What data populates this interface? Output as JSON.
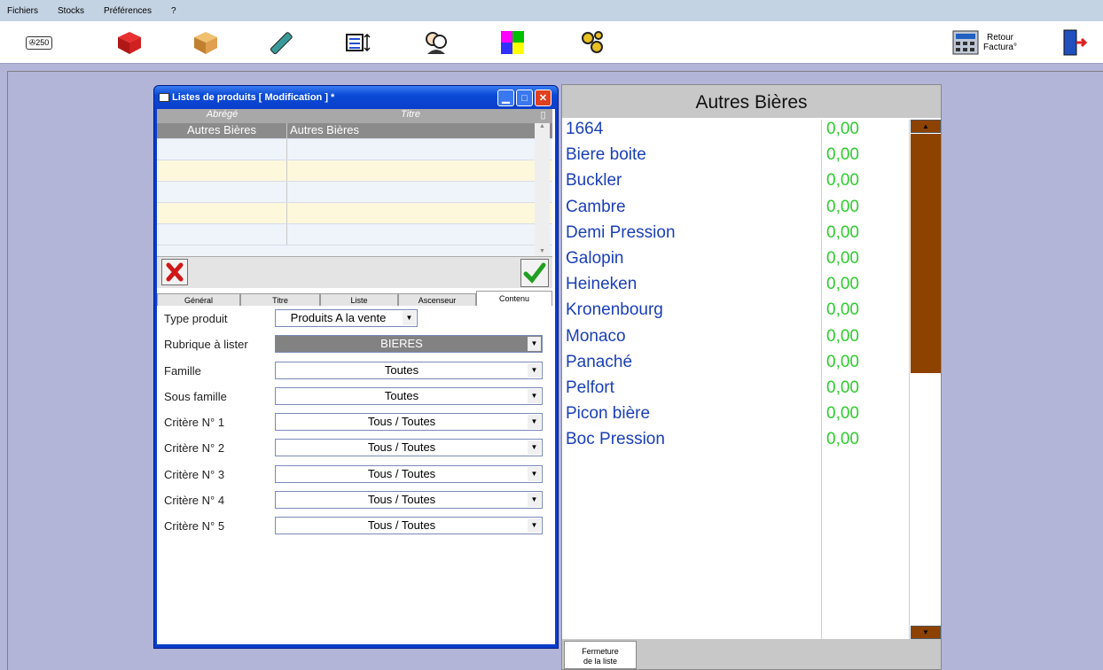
{
  "menu": [
    "Fichiers",
    "Stocks",
    "Préférences",
    "?"
  ],
  "toolbar": {
    "retour_label": "Retour\nFactura°",
    "price_icon_text": "250"
  },
  "dialog": {
    "title": "Listes de produits  [ Modification ] *",
    "grid": {
      "headers": [
        "Abrégé",
        "Titre"
      ],
      "rows": [
        [
          "Autres Bières",
          "Autres Bières"
        ],
        [
          "",
          ""
        ],
        [
          "",
          ""
        ],
        [
          "",
          ""
        ],
        [
          "",
          ""
        ],
        [
          "",
          ""
        ]
      ]
    },
    "tabs": [
      "Général",
      "Titre",
      "Liste",
      "Ascenseur",
      "Contenu"
    ],
    "active_tab": "Contenu",
    "fields": [
      {
        "label": "Type produit",
        "value": "Produits A la vente"
      },
      {
        "label": "Rubrique à lister",
        "value": "BIERES"
      },
      {
        "label": "Famille",
        "value": "Toutes"
      },
      {
        "label": "Sous famille",
        "value": "Toutes"
      },
      {
        "label": "Critère N° 1",
        "value": "Tous / Toutes"
      },
      {
        "label": "Critère N° 2",
        "value": "Tous / Toutes"
      },
      {
        "label": "Critère N° 3",
        "value": "Tous / Toutes"
      },
      {
        "label": "Critère N° 4",
        "value": "Tous / Toutes"
      },
      {
        "label": "Critère N° 5",
        "value": "Tous / Toutes"
      }
    ]
  },
  "panel": {
    "title": "Autres Bières",
    "items": [
      {
        "name": "1664",
        "price": "0,00"
      },
      {
        "name": "Biere boite",
        "price": "0,00"
      },
      {
        "name": "Buckler",
        "price": "0,00"
      },
      {
        "name": "Cambre",
        "price": "0,00"
      },
      {
        "name": "Demi Pression",
        "price": "0,00"
      },
      {
        "name": "Galopin",
        "price": "0,00"
      },
      {
        "name": "Heineken",
        "price": "0,00"
      },
      {
        "name": "Kronenbourg",
        "price": "0,00"
      },
      {
        "name": "Monaco",
        "price": "0,00"
      },
      {
        "name": "Panaché",
        "price": "0,00"
      },
      {
        "name": "Pelfort",
        "price": "0,00"
      },
      {
        "name": "Picon bière",
        "price": "0,00"
      },
      {
        "name": "Boc Pression",
        "price": "0,00"
      }
    ],
    "close_label": "Fermeture\nde la liste"
  },
  "colors": {
    "title_blue": "#0a3ecb",
    "item_blue": "#1a3fb6",
    "price_green": "#2ecc2e",
    "scroll_brown": "#8e4200"
  }
}
